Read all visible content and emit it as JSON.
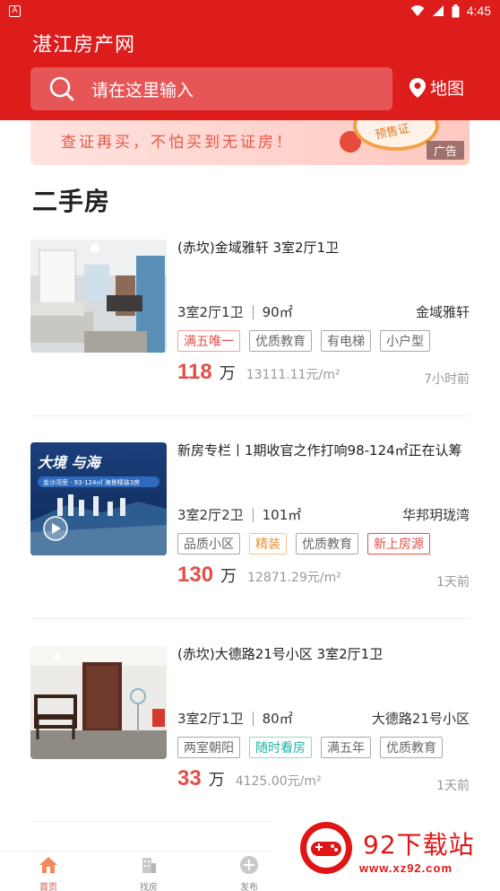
{
  "status_bar": {
    "time": "4:45",
    "app_mark": "A"
  },
  "header": {
    "title": "湛江房产网",
    "search_placeholder": "请在这里输入",
    "map_label": "地图"
  },
  "banner": {
    "slogan": "查证再买，不怕买到无证房！",
    "stamp_text": "预售证",
    "ad_label": "广告"
  },
  "section": {
    "title": "二手房"
  },
  "listings": [
    {
      "title": "(赤坎)金域雅轩 3室2厅1卫",
      "layout": "3室2厅1卫",
      "area": "90㎡",
      "community": "金域雅轩",
      "tags": [
        {
          "text": "满五唯一",
          "style": "red"
        },
        {
          "text": "优质教育",
          "style": "gray"
        },
        {
          "text": "有电梯",
          "style": "gray"
        },
        {
          "text": "小户型",
          "style": "gray"
        }
      ],
      "price": "118",
      "price_unit": "万",
      "unit_price": "13111.11元/m²",
      "time": "7小时前"
    },
    {
      "title": "新房专栏丨1期收官之作打响98-124㎡正在认筹",
      "layout": "3室2厅2卫",
      "area": "101㎡",
      "community": "华邦玥珑湾",
      "thumb_text": "金沙湾旁 · 93-124㎡ 海景精装3房",
      "tags": [
        {
          "text": "品质小区",
          "style": "gray"
        },
        {
          "text": "精装",
          "style": "orange"
        },
        {
          "text": "优质教育",
          "style": "gray"
        },
        {
          "text": "新上房源",
          "style": "redfill"
        }
      ],
      "price": "130",
      "price_unit": "万",
      "unit_price": "12871.29元/m²",
      "time": "1天前"
    },
    {
      "title": "(赤坎)大德路21号小区 3室2厅1卫",
      "layout": "3室2厅1卫",
      "area": "80㎡",
      "community": "大德路21号小区",
      "tags": [
        {
          "text": "两室朝阳",
          "style": "gray"
        },
        {
          "text": "随时看房",
          "style": "teal"
        },
        {
          "text": "满五年",
          "style": "gray"
        },
        {
          "text": "优质教育",
          "style": "gray"
        }
      ],
      "price": "33",
      "price_unit": "万",
      "unit_price": "4125.00元/m²",
      "time": "1天前"
    }
  ],
  "tabbar": [
    {
      "label": "首页",
      "icon": "home-icon",
      "active": true
    },
    {
      "label": "找房",
      "icon": "building-icon",
      "active": false
    },
    {
      "label": "发布",
      "icon": "plus-circle-icon",
      "active": false
    }
  ],
  "watermark": {
    "name": "92下载站",
    "url": "www.xz92.com"
  },
  "colors": {
    "brand_red": "#dd1c1c",
    "price_red": "#e2504a"
  }
}
